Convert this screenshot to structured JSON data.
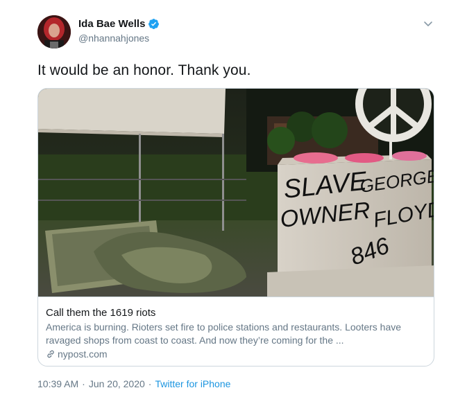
{
  "author": {
    "display_name": "Ida Bae Wells",
    "handle": "@nhannahjones",
    "verified": true
  },
  "tweet": {
    "text": "It would be an honor. Thank you."
  },
  "card": {
    "image_graffiti": {
      "line1": "SLAVE",
      "line2": "OWNER",
      "line3": "GEORGE",
      "line4": "FLOYD",
      "line5": "846"
    },
    "title": "Call them the 1619 riots",
    "description": "America is burning. Rioters set fire to police stations and restaurants. Looters have ravaged shops from coast to coast. And now they’re coming for the ...",
    "domain": "nypost.com"
  },
  "meta": {
    "time": "10:39 AM",
    "date": "Jun 20, 2020",
    "separator": "·",
    "source": "Twitter for iPhone"
  },
  "icons": {
    "verified": "verified-badge-icon",
    "caret": "chevron-down-icon",
    "link": "link-icon"
  },
  "colors": {
    "link_blue": "#1b95e0",
    "verified_blue": "#1da1f2",
    "secondary_text": "#657786",
    "border": "#ccd6dd"
  }
}
